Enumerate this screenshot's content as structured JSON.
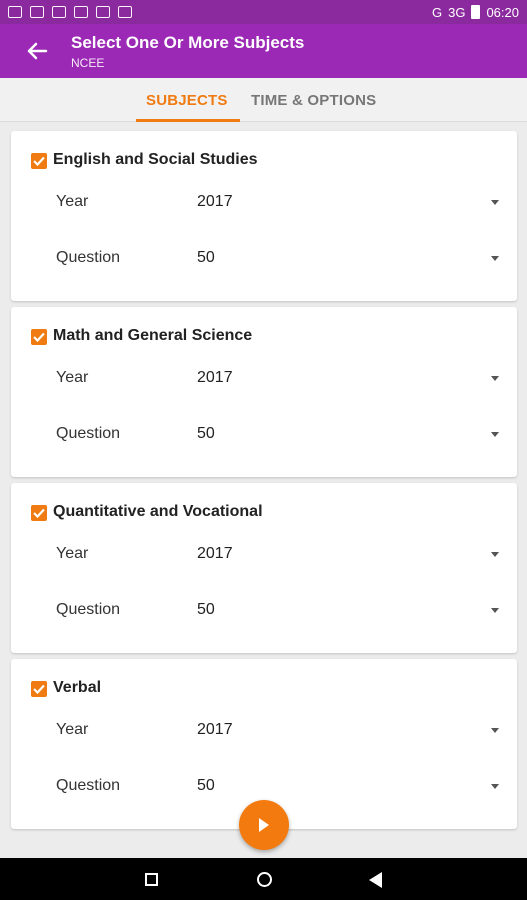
{
  "status": {
    "time": "06:20",
    "network": "3G",
    "carrier_indicator": "G"
  },
  "appbar": {
    "title": "Select One Or More Subjects",
    "subtitle": "NCEE"
  },
  "tabs": [
    {
      "label": "SUBJECTS",
      "active": true
    },
    {
      "label": "TIME & OPTIONS",
      "active": false
    }
  ],
  "subjects": [
    {
      "name": "English and Social Studies",
      "checked": true,
      "year_label": "Year",
      "year": "2017",
      "question_label": "Question",
      "question": "50"
    },
    {
      "name": "Math and General Science",
      "checked": true,
      "year_label": "Year",
      "year": "2017",
      "question_label": "Question",
      "question": "50"
    },
    {
      "name": "Quantitative and Vocational",
      "checked": true,
      "year_label": "Year",
      "year": "2017",
      "question_label": "Question",
      "question": "50"
    },
    {
      "name": "Verbal",
      "checked": true,
      "year_label": "Year",
      "year": "2017",
      "question_label": "Question",
      "question": "50"
    }
  ],
  "colors": {
    "appbar": "#9b29b6",
    "accent": "#ef7b12"
  },
  "icons": {
    "back": "arrow-left-icon",
    "fab": "play-icon"
  }
}
